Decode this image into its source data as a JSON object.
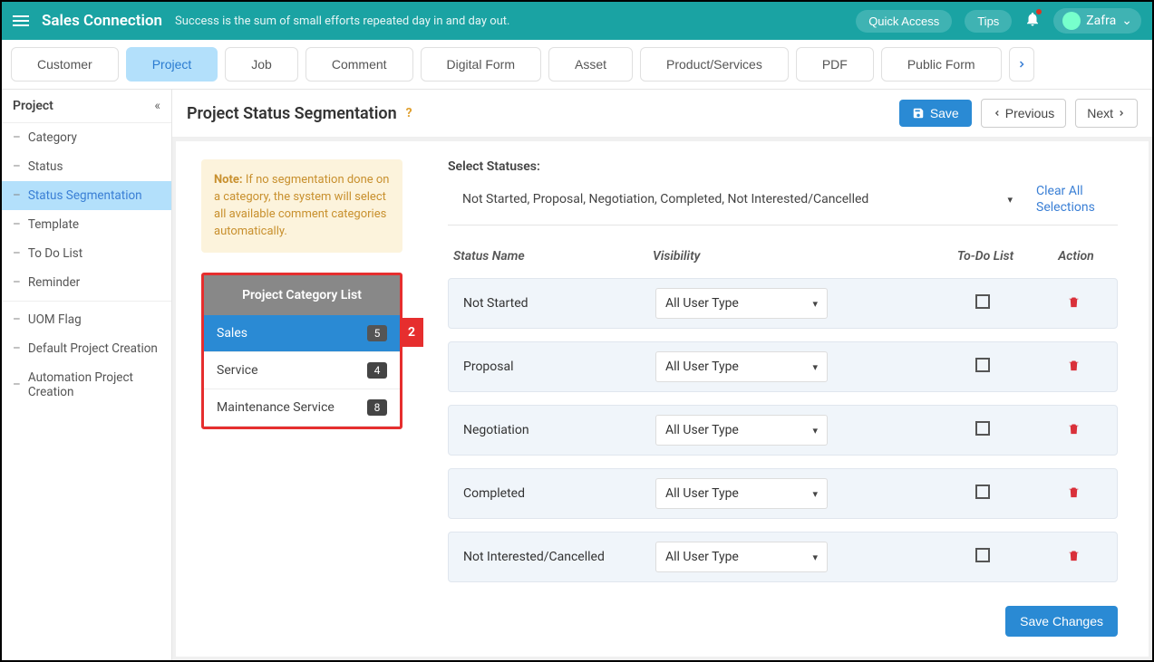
{
  "topbar": {
    "brand": "Sales Connection",
    "tagline": "Success is the sum of small efforts repeated day in and day out.",
    "quick_access": "Quick Access",
    "tips": "Tips",
    "user": "Zafra"
  },
  "tabs": [
    {
      "label": "Customer",
      "active": false
    },
    {
      "label": "Project",
      "active": true
    },
    {
      "label": "Job",
      "active": false
    },
    {
      "label": "Comment",
      "active": false
    },
    {
      "label": "Digital Form",
      "active": false
    },
    {
      "label": "Asset",
      "active": false
    },
    {
      "label": "Product/Services",
      "active": false
    },
    {
      "label": "PDF",
      "active": false
    },
    {
      "label": "Public Form",
      "active": false
    }
  ],
  "sidebar": {
    "title": "Project",
    "groups": [
      [
        "Category",
        "Status",
        "Status Segmentation",
        "Template",
        "To Do List",
        "Reminder"
      ],
      [
        "UOM Flag",
        "Default Project Creation",
        "Automation Project Creation"
      ]
    ],
    "selected": "Status Segmentation"
  },
  "main": {
    "title": "Project Status Segmentation",
    "save": "Save",
    "prev": "Previous",
    "next": "Next",
    "note_label": "Note:",
    "note_text": " If no segmentation done on a category, the system will select all available comment categories automatically.",
    "cat_panel_title": "Project Category List",
    "categories": [
      {
        "name": "Sales",
        "count": "5",
        "selected": true
      },
      {
        "name": "Service",
        "count": "4",
        "selected": false
      },
      {
        "name": "Maintenance Service",
        "count": "8",
        "selected": false
      }
    ],
    "callout": "2",
    "select_label": "Select Statuses:",
    "selected_statuses": "Not Started, Proposal, Negotiation, Completed, Not Interested/Cancelled",
    "clear_all": "Clear All Selections",
    "cols": {
      "name": "Status Name",
      "vis": "Visibility",
      "todo": "To-Do List",
      "action": "Action"
    },
    "statuses": [
      {
        "name": "Not Started",
        "vis": "All User Type"
      },
      {
        "name": "Proposal",
        "vis": "All User Type"
      },
      {
        "name": "Negotiation",
        "vis": "All User Type"
      },
      {
        "name": "Completed",
        "vis": "All User Type"
      },
      {
        "name": "Not Interested/Cancelled",
        "vis": "All User Type"
      }
    ],
    "save_changes": "Save Changes"
  }
}
